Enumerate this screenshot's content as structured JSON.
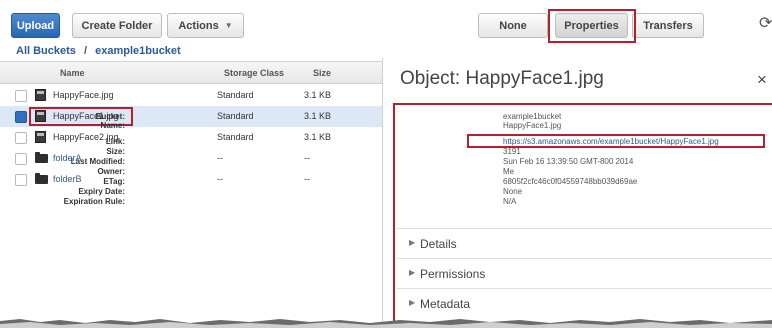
{
  "toolbar": {
    "upload": "Upload",
    "create_folder": "Create Folder",
    "actions": "Actions",
    "none": "None",
    "properties": "Properties",
    "transfers": "Transfers"
  },
  "breadcrumb": {
    "root": "All Buckets",
    "separator": "/",
    "bucket": "example1bucket"
  },
  "table": {
    "headers": {
      "name": "Name",
      "storage_class": "Storage Class",
      "size": "Size"
    },
    "rows": [
      {
        "name": "HappyFace.jpg",
        "storage_class": "Standard",
        "size": "3.1 KB",
        "type": "file",
        "checked": false
      },
      {
        "name": "HappyFace1.jpg",
        "storage_class": "Standard",
        "size": "3.1 KB",
        "type": "file",
        "checked": true
      },
      {
        "name": "HappyFace2.jpg",
        "storage_class": "Standard",
        "size": "3.1 KB",
        "type": "file",
        "checked": false
      },
      {
        "name": "folderA",
        "storage_class": "--",
        "size": "--",
        "type": "folder",
        "checked": false
      },
      {
        "name": "folderB",
        "storage_class": "--",
        "size": "--",
        "type": "folder",
        "checked": false
      }
    ]
  },
  "object": {
    "title": "Object: HappyFace1.jpg",
    "close": "×",
    "properties": [
      {
        "key": "Bucket:",
        "value": "example1bucket"
      },
      {
        "key": "Name:",
        "value": "HappyFace1.jpg"
      },
      {
        "key": "Link:",
        "value": "https://s3.amazonaws.com/example1bucket/HappyFace1.jpg"
      },
      {
        "key": "Size:",
        "value": "3191"
      },
      {
        "key": "Last Modified:",
        "value": "Sun Feb 16 13:39:50 GMT-800 2014"
      },
      {
        "key": "Owner:",
        "value": "Me"
      },
      {
        "key": "ETag:",
        "value": "6805f2cfc46c0f04559748bb039d69ae"
      },
      {
        "key": "Expiry Date:",
        "value": "None"
      },
      {
        "key": "Expiration Rule:",
        "value": "N/A"
      }
    ],
    "sections": [
      "Details",
      "Permissions",
      "Metadata"
    ]
  },
  "colors": {
    "accent": "#2f6ec2",
    "highlight": "#b5202b",
    "link": "#2c5a99"
  }
}
